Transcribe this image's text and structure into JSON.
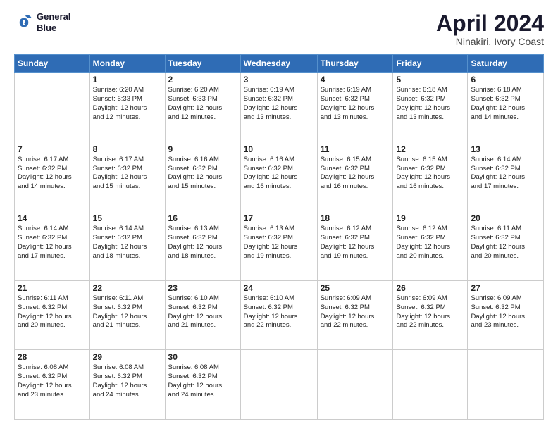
{
  "header": {
    "logo_line1": "General",
    "logo_line2": "Blue",
    "title": "April 2024",
    "subtitle": "Ninakiri, Ivory Coast"
  },
  "days_of_week": [
    "Sunday",
    "Monday",
    "Tuesday",
    "Wednesday",
    "Thursday",
    "Friday",
    "Saturday"
  ],
  "weeks": [
    [
      {
        "day": "",
        "info": ""
      },
      {
        "day": "1",
        "info": "Sunrise: 6:20 AM\nSunset: 6:33 PM\nDaylight: 12 hours\nand 12 minutes."
      },
      {
        "day": "2",
        "info": "Sunrise: 6:20 AM\nSunset: 6:33 PM\nDaylight: 12 hours\nand 12 minutes."
      },
      {
        "day": "3",
        "info": "Sunrise: 6:19 AM\nSunset: 6:32 PM\nDaylight: 12 hours\nand 13 minutes."
      },
      {
        "day": "4",
        "info": "Sunrise: 6:19 AM\nSunset: 6:32 PM\nDaylight: 12 hours\nand 13 minutes."
      },
      {
        "day": "5",
        "info": "Sunrise: 6:18 AM\nSunset: 6:32 PM\nDaylight: 12 hours\nand 13 minutes."
      },
      {
        "day": "6",
        "info": "Sunrise: 6:18 AM\nSunset: 6:32 PM\nDaylight: 12 hours\nand 14 minutes."
      }
    ],
    [
      {
        "day": "7",
        "info": "Sunrise: 6:17 AM\nSunset: 6:32 PM\nDaylight: 12 hours\nand 14 minutes."
      },
      {
        "day": "8",
        "info": "Sunrise: 6:17 AM\nSunset: 6:32 PM\nDaylight: 12 hours\nand 15 minutes."
      },
      {
        "day": "9",
        "info": "Sunrise: 6:16 AM\nSunset: 6:32 PM\nDaylight: 12 hours\nand 15 minutes."
      },
      {
        "day": "10",
        "info": "Sunrise: 6:16 AM\nSunset: 6:32 PM\nDaylight: 12 hours\nand 16 minutes."
      },
      {
        "day": "11",
        "info": "Sunrise: 6:15 AM\nSunset: 6:32 PM\nDaylight: 12 hours\nand 16 minutes."
      },
      {
        "day": "12",
        "info": "Sunrise: 6:15 AM\nSunset: 6:32 PM\nDaylight: 12 hours\nand 16 minutes."
      },
      {
        "day": "13",
        "info": "Sunrise: 6:14 AM\nSunset: 6:32 PM\nDaylight: 12 hours\nand 17 minutes."
      }
    ],
    [
      {
        "day": "14",
        "info": "Sunrise: 6:14 AM\nSunset: 6:32 PM\nDaylight: 12 hours\nand 17 minutes."
      },
      {
        "day": "15",
        "info": "Sunrise: 6:14 AM\nSunset: 6:32 PM\nDaylight: 12 hours\nand 18 minutes."
      },
      {
        "day": "16",
        "info": "Sunrise: 6:13 AM\nSunset: 6:32 PM\nDaylight: 12 hours\nand 18 minutes."
      },
      {
        "day": "17",
        "info": "Sunrise: 6:13 AM\nSunset: 6:32 PM\nDaylight: 12 hours\nand 19 minutes."
      },
      {
        "day": "18",
        "info": "Sunrise: 6:12 AM\nSunset: 6:32 PM\nDaylight: 12 hours\nand 19 minutes."
      },
      {
        "day": "19",
        "info": "Sunrise: 6:12 AM\nSunset: 6:32 PM\nDaylight: 12 hours\nand 20 minutes."
      },
      {
        "day": "20",
        "info": "Sunrise: 6:11 AM\nSunset: 6:32 PM\nDaylight: 12 hours\nand 20 minutes."
      }
    ],
    [
      {
        "day": "21",
        "info": "Sunrise: 6:11 AM\nSunset: 6:32 PM\nDaylight: 12 hours\nand 20 minutes."
      },
      {
        "day": "22",
        "info": "Sunrise: 6:11 AM\nSunset: 6:32 PM\nDaylight: 12 hours\nand 21 minutes."
      },
      {
        "day": "23",
        "info": "Sunrise: 6:10 AM\nSunset: 6:32 PM\nDaylight: 12 hours\nand 21 minutes."
      },
      {
        "day": "24",
        "info": "Sunrise: 6:10 AM\nSunset: 6:32 PM\nDaylight: 12 hours\nand 22 minutes."
      },
      {
        "day": "25",
        "info": "Sunrise: 6:09 AM\nSunset: 6:32 PM\nDaylight: 12 hours\nand 22 minutes."
      },
      {
        "day": "26",
        "info": "Sunrise: 6:09 AM\nSunset: 6:32 PM\nDaylight: 12 hours\nand 22 minutes."
      },
      {
        "day": "27",
        "info": "Sunrise: 6:09 AM\nSunset: 6:32 PM\nDaylight: 12 hours\nand 23 minutes."
      }
    ],
    [
      {
        "day": "28",
        "info": "Sunrise: 6:08 AM\nSunset: 6:32 PM\nDaylight: 12 hours\nand 23 minutes."
      },
      {
        "day": "29",
        "info": "Sunrise: 6:08 AM\nSunset: 6:32 PM\nDaylight: 12 hours\nand 24 minutes."
      },
      {
        "day": "30",
        "info": "Sunrise: 6:08 AM\nSunset: 6:32 PM\nDaylight: 12 hours\nand 24 minutes."
      },
      {
        "day": "",
        "info": ""
      },
      {
        "day": "",
        "info": ""
      },
      {
        "day": "",
        "info": ""
      },
      {
        "day": "",
        "info": ""
      }
    ]
  ]
}
